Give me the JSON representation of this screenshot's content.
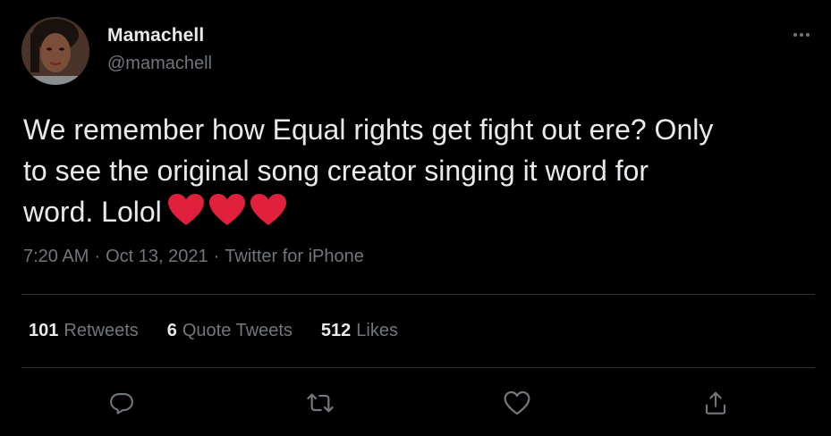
{
  "author": {
    "display_name": "Mamachell",
    "handle": "@mamachell",
    "avatar_icon": "profile-photo"
  },
  "tweet": {
    "text_line1": "We remember how Equal rights get fight out ere? Only",
    "text_line2": "to see the original song creator singing it word for",
    "text_line3": "word. Lolol",
    "emoji": [
      "red-heart",
      "red-heart",
      "red-heart"
    ]
  },
  "meta": {
    "time": "7:20 AM",
    "dot1": "·",
    "date": "Oct 13, 2021",
    "dot2": "·",
    "source": "Twitter for iPhone"
  },
  "stats": {
    "retweets_count": "101",
    "retweets_label": "Retweets",
    "quotes_count": "6",
    "quotes_label": "Quote Tweets",
    "likes_count": "512",
    "likes_label": "Likes"
  },
  "actions": {
    "icons": [
      "reply-icon",
      "retweet-icon",
      "like-icon",
      "share-icon"
    ]
  },
  "colors": {
    "background": "#000000",
    "text_primary": "#e7e9ea",
    "text_secondary": "#71767b",
    "divider": "#2f3336",
    "heart": "#e0203c"
  }
}
